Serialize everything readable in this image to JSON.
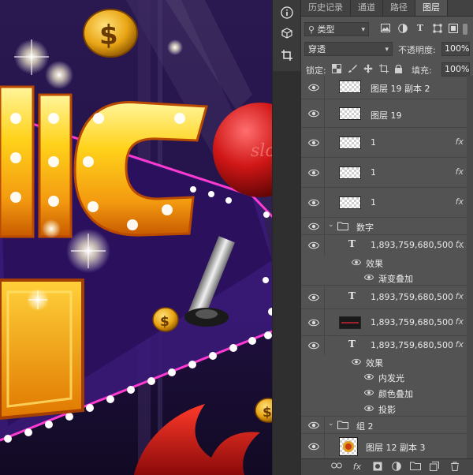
{
  "tabs": [
    "历史记录",
    "通道",
    "路径",
    "图层"
  ],
  "active_tab": "图层",
  "filter": {
    "kind_label": "类型",
    "icons": [
      "image-filter-icon",
      "adjustment-filter-icon",
      "text-filter-icon",
      "shape-filter-icon",
      "smart-object-filter-icon"
    ]
  },
  "blend": {
    "mode": "穿透",
    "opacity_label": "不透明度:",
    "opacity_value": "100%"
  },
  "lock": {
    "label": "锁定:",
    "fill_label": "填充:",
    "fill_value": "100%"
  },
  "layers": [
    {
      "name": "图层 19 副本 2",
      "type": "pixel"
    },
    {
      "name": "图层 19",
      "type": "pixel"
    },
    {
      "name": "1",
      "type": "pixel",
      "fx": true
    },
    {
      "name": "1",
      "type": "pixel",
      "fx": true
    },
    {
      "name": "1",
      "type": "pixel",
      "fx": true
    },
    {
      "name": "数字",
      "type": "group"
    },
    {
      "name": "1,893,759,680,500 ...",
      "type": "text",
      "fx": true,
      "effects_label": "效果",
      "effects": [
        "渐变叠加"
      ]
    },
    {
      "name": "1,893,759,680,500",
      "type": "text",
      "fx": true
    },
    {
      "name": "1,893,759,680,500",
      "type": "pixel-dark",
      "fx": true
    },
    {
      "name": "1,893,759,680,500",
      "type": "text",
      "fx": true,
      "effects_label": "效果",
      "effects": [
        "内发光",
        "颜色叠加",
        "投影"
      ]
    },
    {
      "name": "组 2",
      "type": "group"
    },
    {
      "name": "图层 12 副本 3",
      "type": "pixel-img"
    }
  ],
  "text_layer_glyph": "T",
  "fx_label": "fx",
  "bottom_icons": [
    "link-icon",
    "fx-icon",
    "mask-icon",
    "adjustment-icon",
    "folder-icon",
    "new-layer-icon",
    "trash-icon"
  ],
  "canvas": {
    "lollipop_text": "slot"
  }
}
